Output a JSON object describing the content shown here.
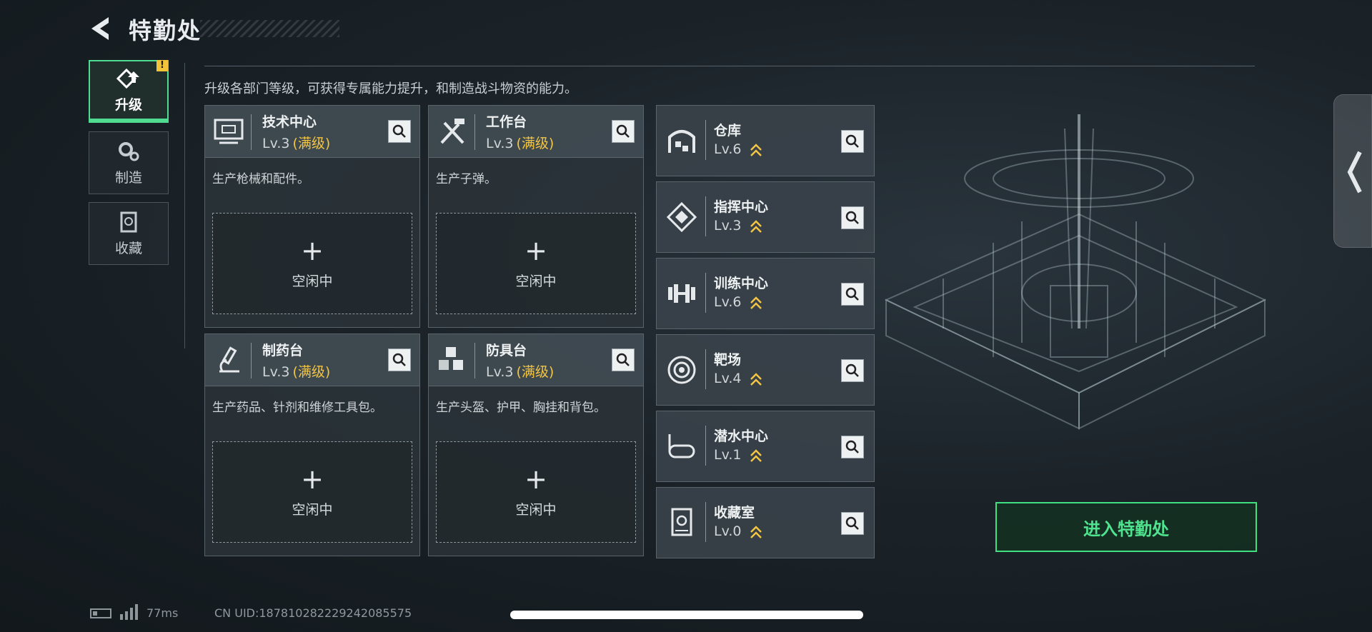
{
  "header": {
    "title": "特勤处"
  },
  "nav": [
    {
      "label": "升级",
      "badge": "!"
    },
    {
      "label": "制造"
    },
    {
      "label": "收藏"
    }
  ],
  "description": "升级各部门等级，可获得专属能力提升，和制造战斗物资的能力。",
  "cards": [
    {
      "name": "技术中心",
      "level": "Lv.3",
      "max": "(满级)",
      "desc": "生产枪械和配件。",
      "slot_plus": "+",
      "slot_status": "空闲中",
      "icon": "monitor-icon"
    },
    {
      "name": "工作台",
      "level": "Lv.3",
      "max": "(满级)",
      "desc": "生产子弹。",
      "slot_plus": "+",
      "slot_status": "空闲中",
      "icon": "tools-icon"
    },
    {
      "name": "制药台",
      "level": "Lv.3",
      "max": "(满级)",
      "desc": "生产药品、针剂和维修工具包。",
      "slot_plus": "+",
      "slot_status": "空闲中",
      "icon": "microscope-icon"
    },
    {
      "name": "防具台",
      "level": "Lv.3",
      "max": "(满级)",
      "desc": "生产头盔、护甲、胸挂和背包。",
      "slot_plus": "+",
      "slot_status": "空闲中",
      "icon": "armor-cubes-icon"
    }
  ],
  "facilities": [
    {
      "name": "仓库",
      "level": "Lv.6",
      "icon": "warehouse-icon"
    },
    {
      "name": "指挥中心",
      "level": "Lv.3",
      "icon": "command-icon"
    },
    {
      "name": "训练中心",
      "level": "Lv.6",
      "icon": "dumbbell-icon"
    },
    {
      "name": "靶场",
      "level": "Lv.4",
      "icon": "target-icon"
    },
    {
      "name": "潜水中心",
      "level": "Lv.1",
      "icon": "diving-mask-icon"
    },
    {
      "name": "收藏室",
      "level": "Lv.0",
      "icon": "vault-icon"
    }
  ],
  "enter_button": "进入特勤处",
  "status": {
    "ping": "77ms",
    "uid": "CN UID:187810282229242085575"
  },
  "colors": {
    "accent": "#4fdc91",
    "max_level": "#f2c544",
    "badge": "#f3c33a"
  }
}
